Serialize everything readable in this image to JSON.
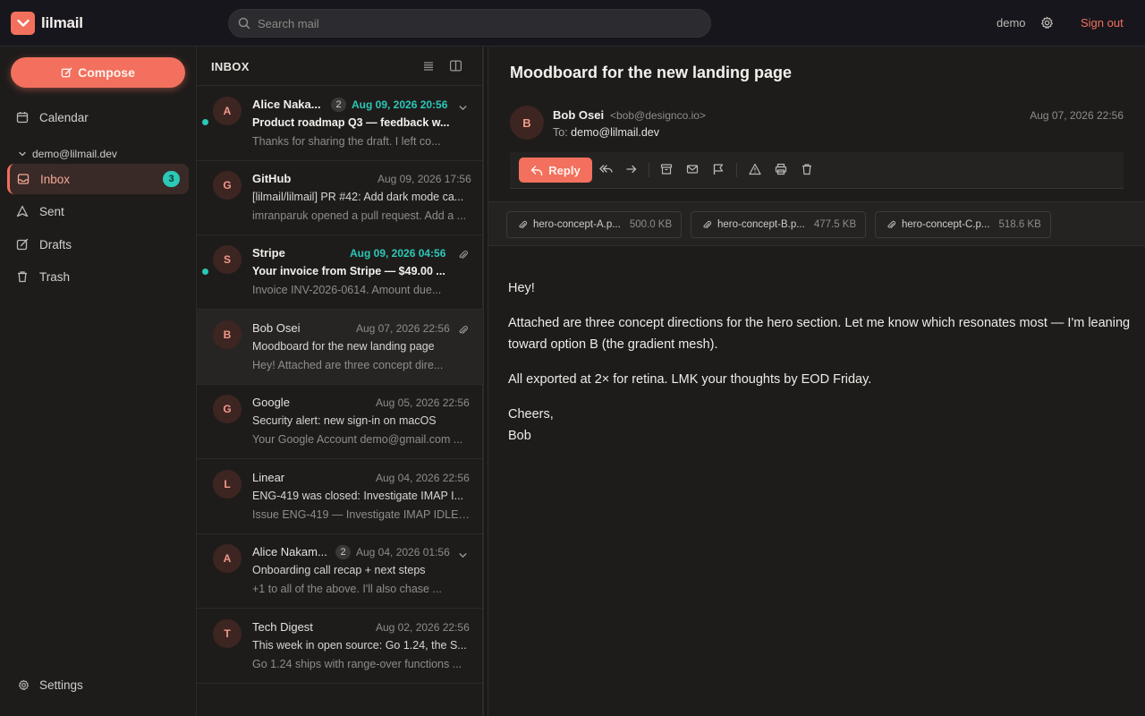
{
  "app": {
    "name": "lilmail"
  },
  "topbar": {
    "search_placeholder": "Search mail",
    "user": "demo",
    "sign_out": "Sign out"
  },
  "sidebar": {
    "compose": "Compose",
    "calendar": "Calendar",
    "account": "demo@lilmail.dev",
    "items": [
      {
        "label": "Inbox",
        "count": "3",
        "icon": "inbox-icon"
      },
      {
        "label": "Sent",
        "icon": "send-icon"
      },
      {
        "label": "Drafts",
        "icon": "pencil-icon"
      },
      {
        "label": "Trash",
        "icon": "trash-icon"
      }
    ],
    "settings": "Settings"
  },
  "list": {
    "title": "INBOX",
    "messages": [
      {
        "initial": "A",
        "sender": "Alice Naka...",
        "count": "2",
        "date": "Aug 09, 2026 20:56",
        "subject": "Product roadmap Q3 — feedback w...",
        "preview": "Thanks for sharing the draft. I left co...",
        "unread": true,
        "icon": "chevron"
      },
      {
        "initial": "G",
        "sender": "GitHub",
        "date": "Aug 09, 2026 17:56",
        "subject": "[lilmail/lilmail] PR #42: Add dark mode ca...",
        "preview": "imranparuk opened a pull request. Add a ...",
        "unread": false
      },
      {
        "initial": "S",
        "sender": "Stripe",
        "date": "Aug 09, 2026 04:56",
        "subject": "Your invoice from Stripe — $49.00 ...",
        "preview": "Invoice INV-2026-0614. Amount due...",
        "unread": true,
        "icon": "paperclip"
      },
      {
        "initial": "B",
        "sender": "Bob Osei",
        "date": "Aug 07, 2026 22:56",
        "subject": "Moodboard for the new landing page",
        "preview": "Hey! Attached are three concept dire...",
        "unread": false,
        "selected": true,
        "icon": "paperclip"
      },
      {
        "initial": "G",
        "sender": "Google",
        "date": "Aug 05, 2026 22:56",
        "subject": "Security alert: new sign-in on macOS",
        "preview": "Your Google Account demo@gmail.com ...",
        "unread": false
      },
      {
        "initial": "L",
        "sender": "Linear",
        "date": "Aug 04, 2026 22:56",
        "subject": "ENG-419 was closed: Investigate IMAP I...",
        "preview": "Issue ENG-419 — Investigate IMAP IDLE r...",
        "unread": false
      },
      {
        "initial": "A",
        "sender": "Alice Nakam...",
        "count": "2",
        "date": "Aug 04, 2026 01:56",
        "subject": "Onboarding call recap + next steps",
        "preview": "+1 to all of the above. I'll also chase ...",
        "unread": false,
        "icon": "chevron"
      },
      {
        "initial": "T",
        "sender": "Tech Digest",
        "date": "Aug 02, 2026 22:56",
        "subject": "This week in open source: Go 1.24, the S...",
        "preview": "Go 1.24 ships with range-over functions ...",
        "unread": false
      }
    ]
  },
  "reader": {
    "title": "Moodboard for the new landing page",
    "from_initial": "B",
    "from_name": "Bob Osei",
    "from_email": "<bob@designco.io>",
    "to_label": "To:",
    "to": "demo@lilmail.dev",
    "date": "Aug 07, 2026 22:56",
    "reply": "Reply",
    "attachments": [
      {
        "name": "hero-concept-A.p...",
        "size": "500.0 KB"
      },
      {
        "name": "hero-concept-B.p...",
        "size": "477.5 KB"
      },
      {
        "name": "hero-concept-C.p...",
        "size": "518.6 KB"
      }
    ],
    "body": [
      "Hey!",
      "Attached are three concept directions for the hero section. Let me know which resonates most — I'm leaning toward option B (the gradient mesh).",
      "All exported at 2× for retina. LMK your thoughts by EOD Friday.",
      "Cheers,",
      "Bob"
    ]
  },
  "colors": {
    "accent": "#f2705d",
    "teal": "#2bc8b6",
    "bg": "#1e1c1b"
  }
}
